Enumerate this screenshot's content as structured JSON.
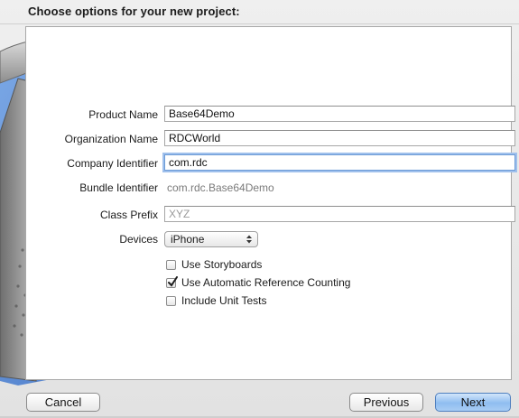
{
  "sheet": {
    "title": "Choose options for your new project:"
  },
  "form": {
    "product_name": {
      "label": "Product Name",
      "value": "Base64Demo"
    },
    "organization_name": {
      "label": "Organization Name",
      "value": "RDCWorld"
    },
    "company_identifier": {
      "label": "Company Identifier",
      "value": "com.rdc"
    },
    "bundle_identifier": {
      "label": "Bundle Identifier",
      "value": "com.rdc.Base64Demo"
    },
    "class_prefix": {
      "label": "Class Prefix",
      "placeholder": "XYZ",
      "value": ""
    },
    "devices": {
      "label": "Devices",
      "selected": "iPhone"
    },
    "options": [
      {
        "label": "Use Storyboards",
        "checked": false
      },
      {
        "label": "Use Automatic Reference Counting",
        "checked": true
      },
      {
        "label": "Include Unit Tests",
        "checked": false
      }
    ]
  },
  "buttons": {
    "cancel": "Cancel",
    "previous": "Previous",
    "next": "Next"
  },
  "colors": {
    "focus_ring": "#9fc0ec",
    "primary_button": "#8fbdf0",
    "artwork_blue": "#5f8fd6"
  },
  "icons": {
    "popup": "updown-arrows-icon",
    "checkbox": "checkmark-icon",
    "artwork": "hammer-blueprint-icon"
  }
}
